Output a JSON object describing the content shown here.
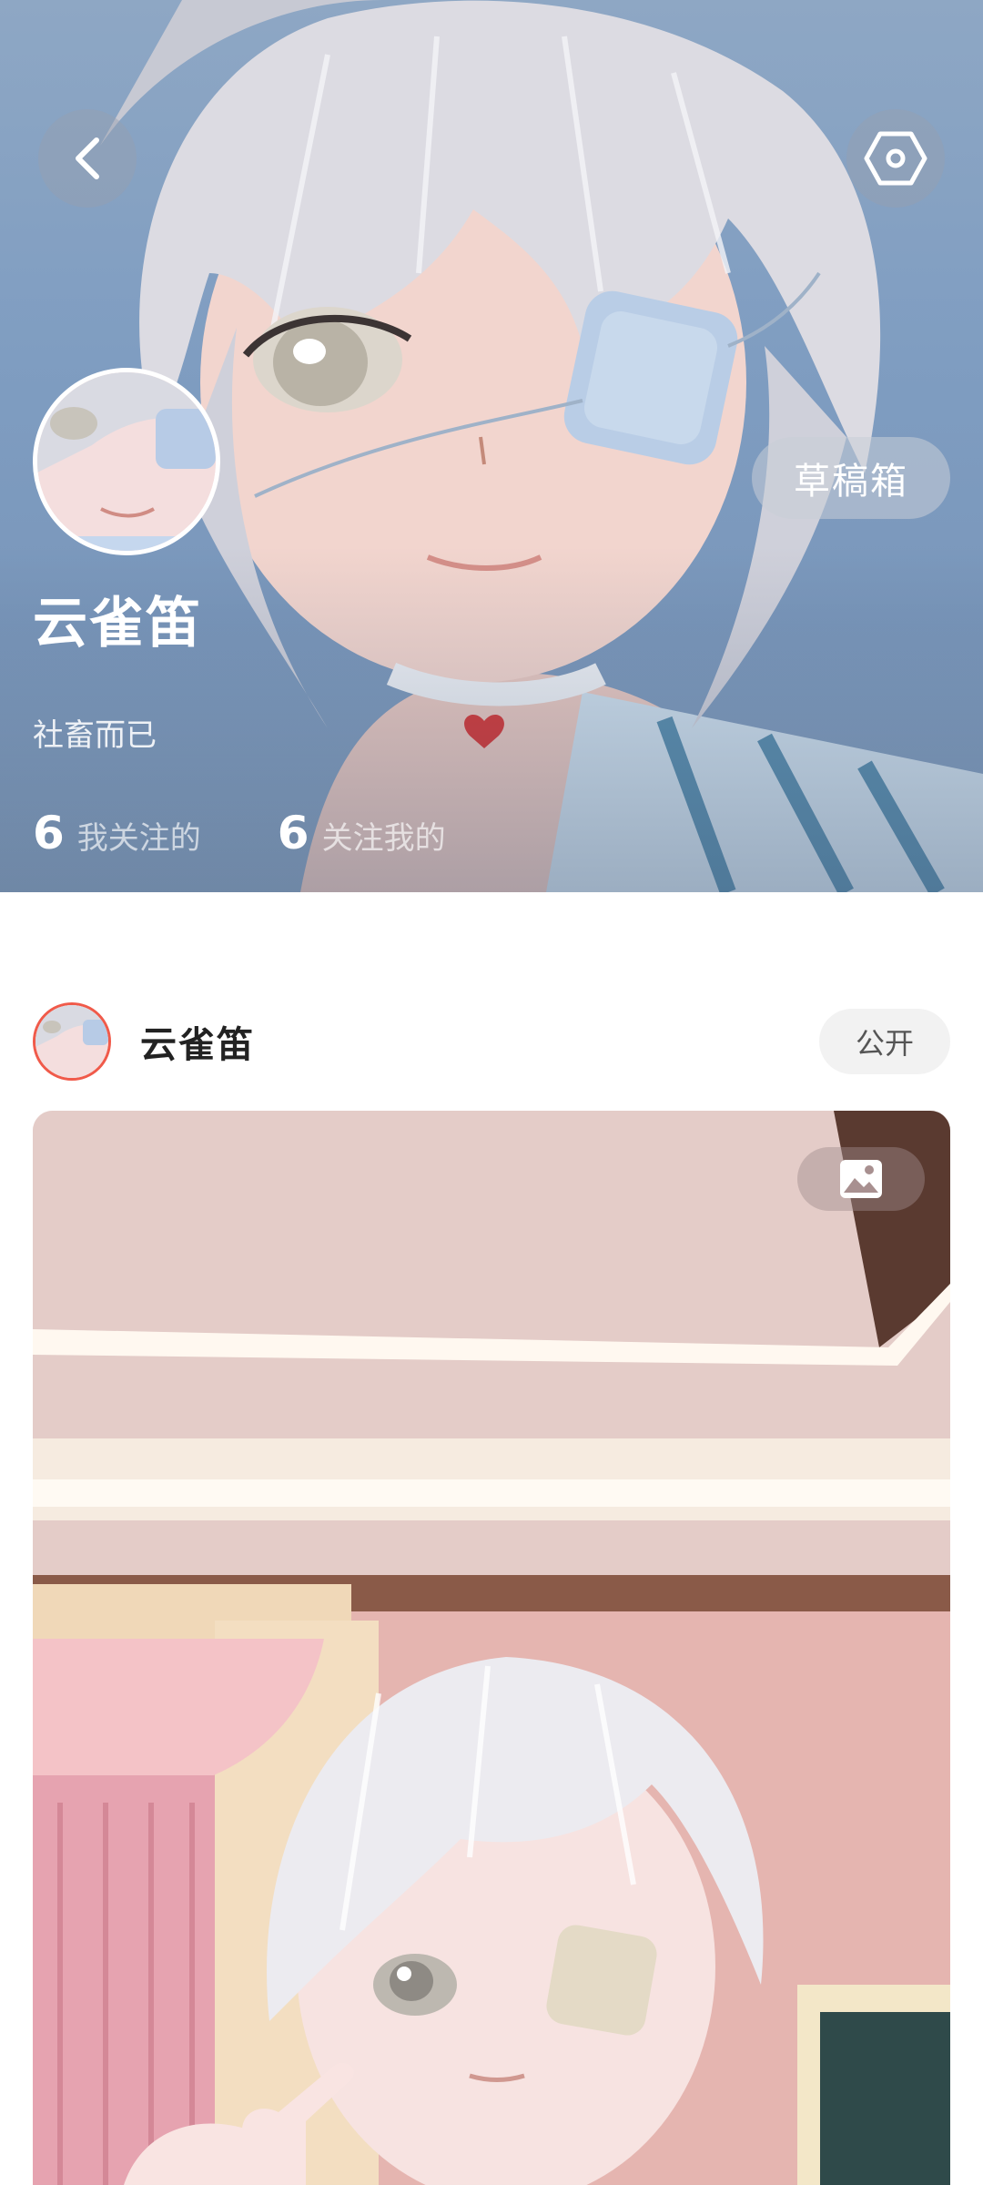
{
  "profile": {
    "name": "云雀笛",
    "bio": "社畜而已",
    "draft_box_label": "草稿箱",
    "following_count": "6",
    "following_label": "我关注的",
    "followers_count": "6",
    "followers_label": "关注我的"
  },
  "header_icons": {
    "back": "back-arrow-icon",
    "settings": "hexagon-settings-icon"
  },
  "post": {
    "author": "云雀笛",
    "visibility": "公开",
    "media_type_icon": "image-icon"
  },
  "colors": {
    "avatar_ring": "#f05a4a",
    "cover_bg": "#7f9dc1",
    "badge_bg": "#f2f2f2"
  }
}
